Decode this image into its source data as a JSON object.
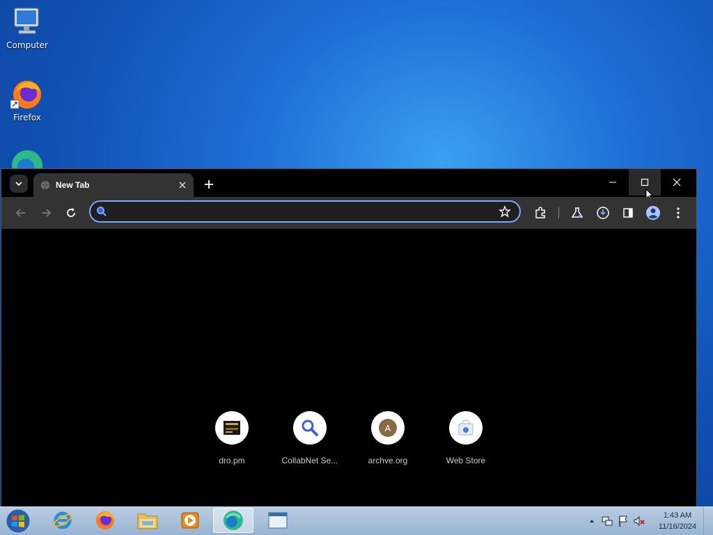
{
  "desktop": {
    "icons": [
      {
        "label": "Computer",
        "icon": "computer-icon"
      },
      {
        "label": "Firefox",
        "icon": "firefox-icon"
      },
      {
        "label": "",
        "icon": "edge-icon"
      }
    ]
  },
  "browser": {
    "tab": {
      "title": "New Tab",
      "icon": "globe-icon"
    },
    "omnibox": {
      "placeholder": "",
      "value": ""
    },
    "shortcuts": [
      {
        "label": "dro.pm",
        "icon": "dro-favicon"
      },
      {
        "label": "CollabNet Se...",
        "icon": "search-icon"
      },
      {
        "label": "archve.org",
        "icon": "letter-a-icon",
        "letter": "A"
      },
      {
        "label": "Web Store",
        "icon": "webstore-icon"
      }
    ]
  },
  "taskbar": {
    "items": [
      {
        "name": "internet-explorer",
        "icon": "ie-icon"
      },
      {
        "name": "firefox",
        "icon": "firefox-icon"
      },
      {
        "name": "file-explorer",
        "icon": "folder-icon"
      },
      {
        "name": "media-player",
        "icon": "media-player-icon"
      },
      {
        "name": "edge",
        "icon": "edge-icon",
        "active": true
      },
      {
        "name": "window",
        "icon": "window-icon"
      }
    ],
    "clock": {
      "time": "1:43 AM",
      "date": "11/16/2024"
    }
  },
  "colors": {
    "accent": "#7aa7ff",
    "toolbar": "#333333",
    "content": "#000000"
  }
}
